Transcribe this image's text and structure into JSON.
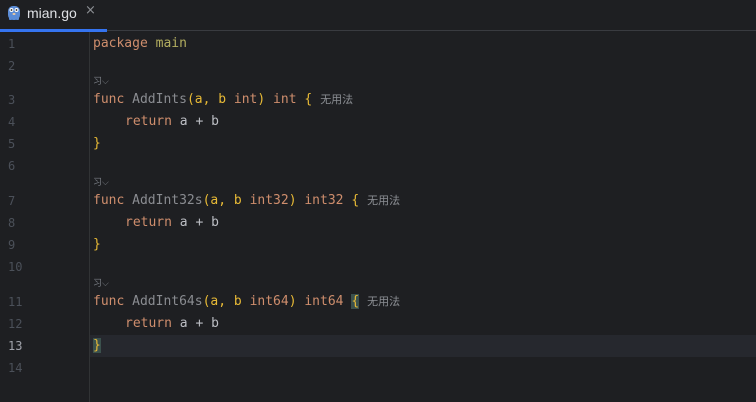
{
  "tab": {
    "filename": "mian.go",
    "close": "×",
    "icon": "gopher-icon",
    "accent": "#3574f0"
  },
  "editor": {
    "current_line": 13,
    "line_numbers": [
      "1",
      "2",
      "3",
      "4",
      "5",
      "6",
      "7",
      "8",
      "9",
      "10",
      "11",
      "12",
      "13",
      "14"
    ],
    "lines": {
      "l1": {
        "keyword": "package",
        "name": "main"
      },
      "l3": {
        "func": "func",
        "name": "AddInts",
        "open": "(a, b ",
        "type": "int",
        "close": ")",
        "ret": "int",
        "brace": "{",
        "hint": "无用法"
      },
      "l4": {
        "ret_kw": "return",
        "expr": "a + b"
      },
      "l5": {
        "brace": "}"
      },
      "l7": {
        "func": "func",
        "name": "AddInt32s",
        "open": "(a, b ",
        "type": "int32",
        "close": ")",
        "ret": "int32",
        "brace": "{",
        "hint": "无用法"
      },
      "l8": {
        "ret_kw": "return",
        "expr": "a + b"
      },
      "l9": {
        "brace": "}"
      },
      "l11": {
        "func": "func",
        "name": "AddInt64s",
        "open": "(a, b ",
        "type": "int64",
        "close": ")",
        "ret": "int64",
        "brace": "{",
        "hint": "无用法"
      },
      "l12": {
        "ret_kw": "return",
        "expr": "a + b"
      },
      "l13": {
        "brace": "}"
      }
    },
    "usage_marker": "习⌵"
  },
  "colors": {
    "background": "#1e1f22",
    "keyword": "#cf8e6d",
    "brace": "#e8ba36",
    "text": "#bcbec4"
  }
}
